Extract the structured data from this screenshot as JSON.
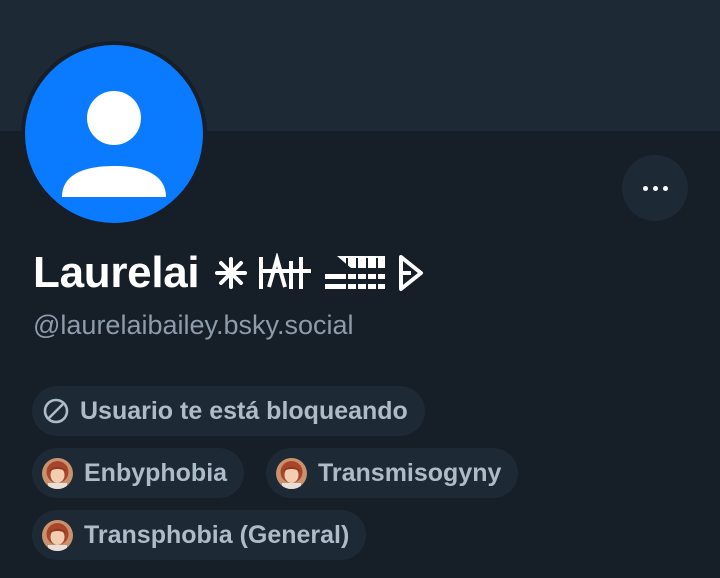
{
  "profile": {
    "display_name": "Laurelai",
    "handle": "@laurelaibailey.bsky.social",
    "avatar_color": "#0a7aff"
  },
  "actions": {
    "more_icon": "ellipsis-icon"
  },
  "blocked_notice": {
    "icon": "block-icon",
    "label": "Usuario te está bloqueando"
  },
  "labels": [
    {
      "label": "Enbyphobia",
      "icon": "labeler-avatar"
    },
    {
      "label": "Transmisogyny",
      "icon": "labeler-avatar"
    },
    {
      "label": "Transphobia (General)",
      "icon": "labeler-avatar"
    }
  ],
  "colors": {
    "background": "#161e27",
    "banner": "#1e2936",
    "pill_background": "#1e2936",
    "pill_text": "#aebbc9",
    "handle_text": "#8d9bab",
    "name_text": "#ffffff"
  }
}
